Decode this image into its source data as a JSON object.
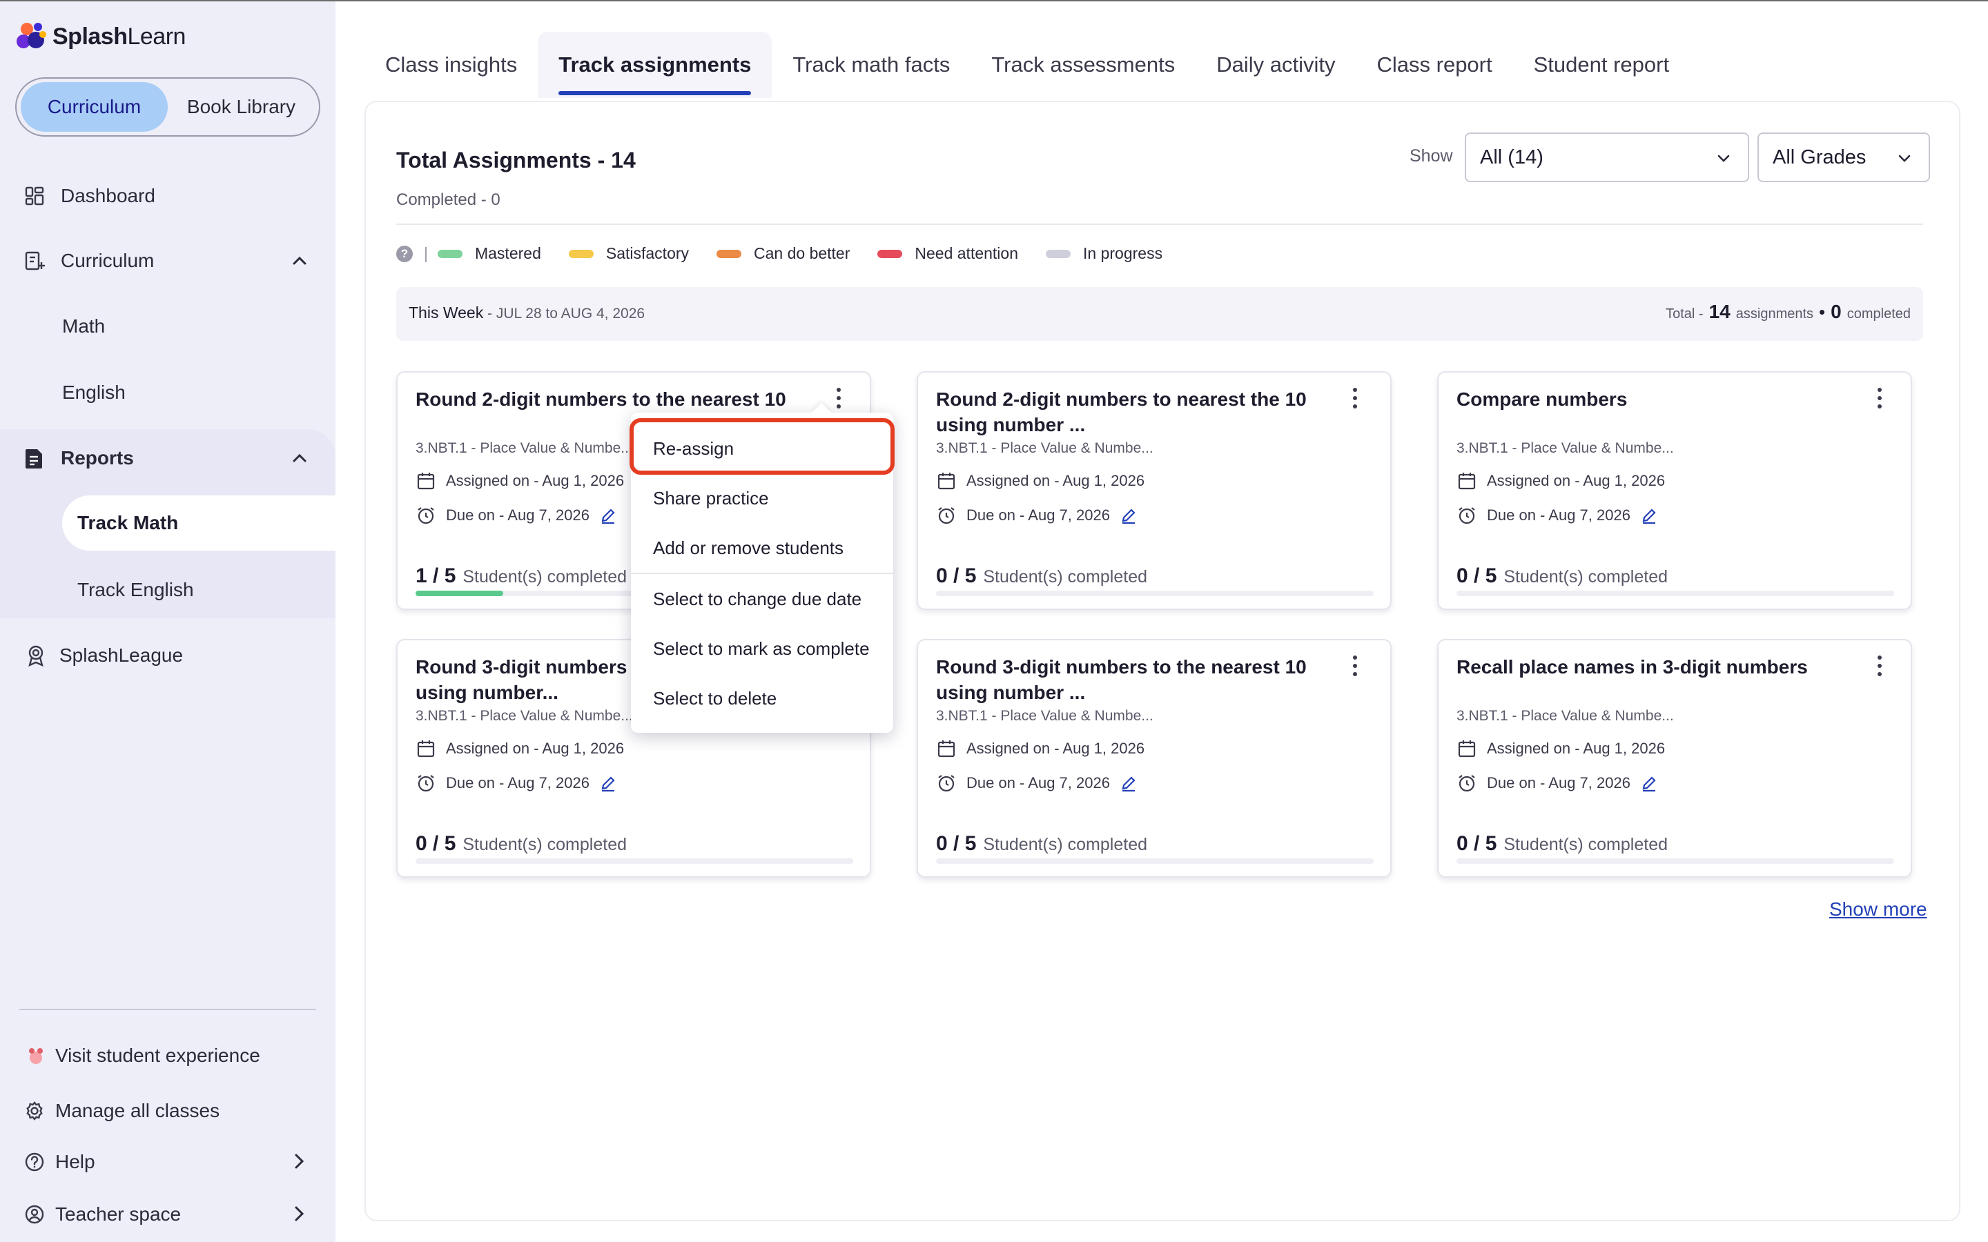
{
  "app": {
    "brand_bold": "Splash",
    "brand_regular": "Learn"
  },
  "sidebar": {
    "segment": {
      "active": "Curriculum",
      "inactive": "Book Library"
    },
    "items": [
      {
        "label": "Dashboard",
        "icon": "dashboard-icon"
      },
      {
        "label": "Curriculum",
        "icon": "curriculum-icon",
        "expanded": true
      },
      {
        "label": "Math"
      },
      {
        "label": "English"
      },
      {
        "label": "Reports",
        "icon": "reports-icon",
        "expanded": true
      },
      {
        "label": "Track Math",
        "active": true
      },
      {
        "label": "Track English"
      },
      {
        "label": "SplashLeague",
        "icon": "league-icon"
      }
    ],
    "bottom": [
      {
        "label": "Visit student experience",
        "icon": "student-icon"
      },
      {
        "label": "Manage all classes",
        "icon": "gear-icon"
      },
      {
        "label": "Help",
        "icon": "help-icon"
      },
      {
        "label": "Teacher space",
        "icon": "teacher-icon"
      }
    ]
  },
  "tabs": [
    {
      "label": "Class insights"
    },
    {
      "label": "Track assignments",
      "active": true
    },
    {
      "label": "Track math facts"
    },
    {
      "label": "Track assessments"
    },
    {
      "label": "Daily activity"
    },
    {
      "label": "Class report"
    },
    {
      "label": "Student report"
    }
  ],
  "summary": {
    "title": "Total Assignments - 14",
    "completed": "Completed - 0",
    "show_label": "Show",
    "filter_value": "All (14)",
    "grade_value": "All Grades"
  },
  "legend": {
    "help_glyph": "?",
    "separator": "|",
    "items": [
      {
        "label": "Mastered",
        "color": "#7fd39a"
      },
      {
        "label": "Satisfactory",
        "color": "#f5c94a"
      },
      {
        "label": "Can do better",
        "color": "#ea8a45"
      },
      {
        "label": "Need attention",
        "color": "#e64b5c"
      },
      {
        "label": "In progress",
        "color": "#cfcfdc"
      }
    ]
  },
  "week": {
    "label": "This Week",
    "range": " - JUL 28 to AUG 4, 2026",
    "total_prefix": "Total -",
    "total_count": "14",
    "total_suffix": "assignments",
    "bullet": "•",
    "completed_count": "0",
    "completed_suffix": "completed"
  },
  "cards": [
    {
      "title": "Round 2-digit numbers to the nearest 10",
      "standard": "3.NBT.1 - Place Value & Numbe...",
      "assigned": "Assigned on - Aug 1, 2026",
      "due": "Due on - Aug 7, 2026",
      "done": "1 / 5",
      "done_label": "Student(s) completed",
      "progress": 0.2
    },
    {
      "title": "Round 2-digit numbers to nearest the 10 using number ...",
      "standard": "3.NBT.1 - Place Value & Numbe...",
      "assigned": "Assigned on - Aug 1, 2026",
      "due": "Due on - Aug 7, 2026",
      "done": "0 / 5",
      "done_label": "Student(s) completed",
      "progress": 0
    },
    {
      "title": "Compare numbers",
      "standard": "3.NBT.1 - Place Value & Numbe...",
      "assigned": "Assigned on - Aug 1, 2026",
      "due": "Due on - Aug 7, 2026",
      "done": "0 / 5",
      "done_label": "Student(s) completed",
      "progress": 0
    },
    {
      "title": "Round 3-digit numbers to the nearest 10 using number...",
      "standard": "3.NBT.1 - Place Value & Numbe...",
      "assigned": "Assigned on - Aug 1, 2026",
      "due": "Due on - Aug 7, 2026",
      "done": "0 / 5",
      "done_label": "Student(s) completed",
      "progress": 0
    },
    {
      "title": "Round 3-digit numbers to the nearest 10 using number ...",
      "standard": "3.NBT.1 - Place Value & Numbe...",
      "assigned": "Assigned on - Aug 1, 2026",
      "due": "Due on - Aug 7, 2026",
      "done": "0 / 5",
      "done_label": "Student(s) completed",
      "progress": 0
    },
    {
      "title": "Recall place names in 3-digit numbers",
      "standard": "3.NBT.1 - Place Value & Numbe...",
      "assigned": "Assigned on - Aug 1, 2026",
      "due": "Due on - Aug 7, 2026",
      "done": "0 / 5",
      "done_label": "Student(s) completed",
      "progress": 0
    }
  ],
  "show_more": "Show more",
  "menu": {
    "items": [
      {
        "label": "Re-assign",
        "highlighted": true
      },
      {
        "label": "Share practice"
      },
      {
        "label": "Add or remove students"
      },
      {
        "label": "Select to change due date"
      },
      {
        "label": "Select to mark as complete"
      },
      {
        "label": "Select to delete"
      }
    ]
  },
  "colors": {
    "accent": "#2340b8",
    "highlight_border": "#e53d22",
    "sidebar_bg": "#eeeef8",
    "segment_active": "#a8cdf7",
    "progress_fill": "#5cc98c"
  }
}
